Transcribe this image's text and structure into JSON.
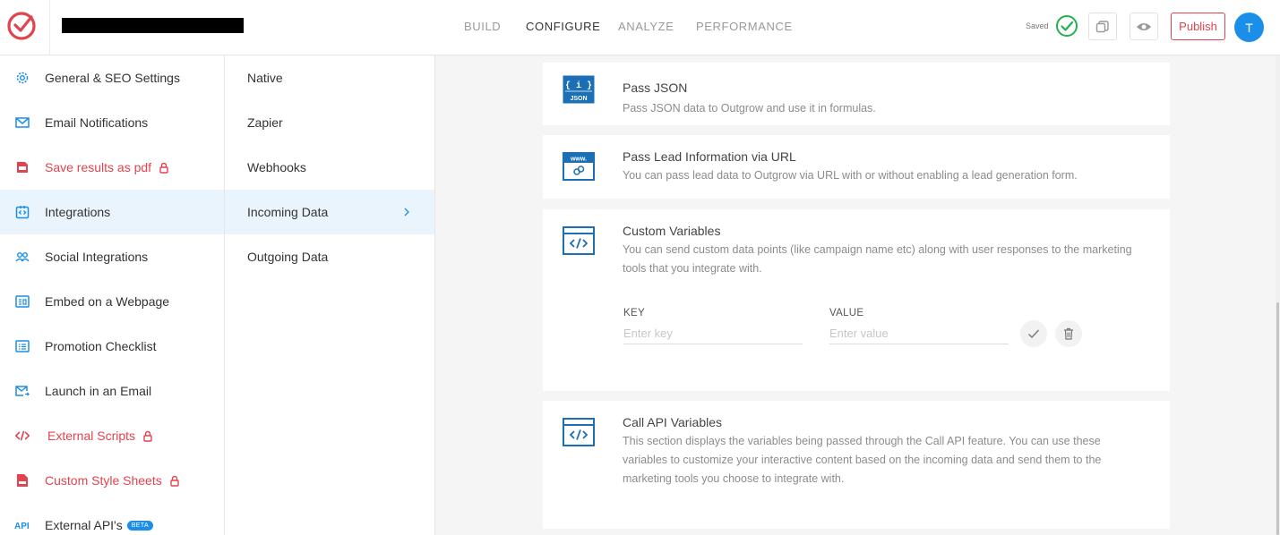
{
  "header": {
    "logo_icon": "outgrow-logo-icon",
    "tabs": [
      {
        "label": "BUILD"
      },
      {
        "label": "CONFIGURE"
      },
      {
        "label": "ANALYZE"
      },
      {
        "label": "PERFORMANCE"
      }
    ],
    "active_tab": "CONFIGURE",
    "saved_label": "Saved",
    "publish_label": "Publish",
    "avatar_initial": "T"
  },
  "sidebar": {
    "items": [
      {
        "label": "General & SEO Settings",
        "icon": "gear-icon"
      },
      {
        "label": "Email Notifications",
        "icon": "envelope-icon"
      },
      {
        "label": "Save results as pdf",
        "icon": "pdf-icon",
        "locked": true
      },
      {
        "label": "Integrations",
        "icon": "integrations-icon",
        "active": true
      },
      {
        "label": "Social Integrations",
        "icon": "people-icon"
      },
      {
        "label": "Embed on a Webpage",
        "icon": "embed-icon"
      },
      {
        "label": "Promotion Checklist",
        "icon": "checklist-icon"
      },
      {
        "label": "Launch in an Email",
        "icon": "email-launch-icon"
      },
      {
        "label": "External Scripts",
        "icon": "code-icon",
        "locked": true
      },
      {
        "label": "Custom Style Sheets",
        "icon": "css-file-icon",
        "locked": true
      },
      {
        "label": "External API's",
        "icon": "api-icon",
        "badge": "BETA"
      }
    ]
  },
  "subnav": {
    "items": [
      {
        "label": "Native"
      },
      {
        "label": "Zapier"
      },
      {
        "label": "Webhooks"
      },
      {
        "label": "Incoming Data",
        "active": true
      },
      {
        "label": "Outgoing Data"
      }
    ]
  },
  "main": {
    "cards": [
      {
        "icon": "json-icon",
        "title": "Pass JSON",
        "description": "Pass JSON data to Outgrow and use it in formulas."
      },
      {
        "icon": "url-link-icon",
        "title": "Pass Lead Information via URL",
        "description": "You can pass lead data to Outgrow via URL with or without enabling a lead generation form."
      },
      {
        "icon": "code-window-icon",
        "title": "Custom Variables",
        "description": "You can send custom data points (like campaign name etc) along with user responses to the marketing tools that you integrate with."
      },
      {
        "icon": "code-window-icon",
        "title": "Call API Variables",
        "description": "This section displays the variables being passed through the Call API feature. You can use these variables to customize your interactive content based on the incoming data and send them to the marketing tools you choose to integrate with."
      }
    ],
    "custom_vars": {
      "key_label": "KEY",
      "key_placeholder": "Enter key",
      "value_label": "VALUE",
      "value_placeholder": "Enter value"
    }
  },
  "colors": {
    "accent_blue": "#1a8ee8",
    "brand_red": "#e0444e",
    "saved_green": "#22b14c",
    "active_bg": "#eaf4fd"
  }
}
